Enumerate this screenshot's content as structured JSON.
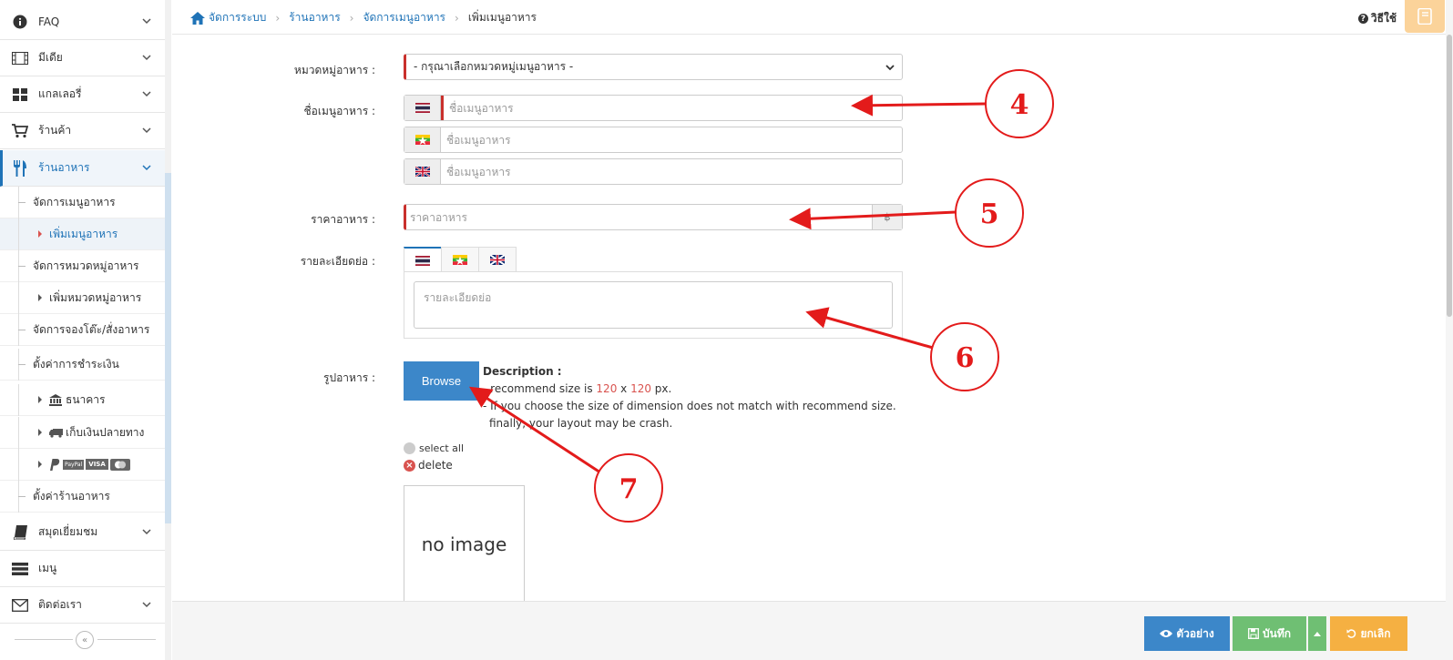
{
  "sidebar": {
    "items": [
      {
        "label": "FAQ",
        "icon": "info-icon"
      },
      {
        "label": "มีเดีย",
        "icon": "film-icon"
      },
      {
        "label": "แกลเลอรี่",
        "icon": "grid-icon"
      },
      {
        "label": "ร้านค้า",
        "icon": "cart-icon"
      },
      {
        "label": "ร้านอาหาร",
        "icon": "utensils-icon"
      },
      {
        "label": "สมุดเยี่ยมชม",
        "icon": "book-icon"
      },
      {
        "label": "เมนู",
        "icon": "menu-icon"
      },
      {
        "label": "ติดต่อเรา",
        "icon": "mail-icon"
      }
    ],
    "sub": [
      {
        "label": "จัดการเมนูอาหาร"
      },
      {
        "label": "เพิ่มเมนูอาหาร"
      },
      {
        "label": "จัดการหมวดหมู่อาหาร"
      },
      {
        "label": "เพิ่มหมวดหมู่อาหาร"
      },
      {
        "label": "จัดการจองโต๊ะ/สั่งอาหาร"
      },
      {
        "label": "ตั้งค่าการชำระเงิน"
      },
      {
        "label": "ธนาคาร"
      },
      {
        "label": "เก็บเงินปลายทาง"
      },
      {
        "label": "ตั้งค่าร้านอาหาร"
      }
    ],
    "paypal_label": "PayPal",
    "visa_label": "VISA"
  },
  "breadcrumb": [
    "จัดการระบบ",
    "ร้านอาหาร",
    "จัดการเมนูอาหาร",
    "เพิ่มเมนูอาหาร"
  ],
  "help_label": "วิธีใช้",
  "form": {
    "category_label": "หมวดหมู่อาหาร :",
    "category_value": "- กรุณาเลือกหมวดหมู่เมนูอาหาร -",
    "name_label": "ชื่อเมนูอาหาร :",
    "name_placeholder": "ชื่อเมนูอาหาร",
    "price_label": "ราคาอาหาร :",
    "price_placeholder": "ราคาอาหาร",
    "detail_label": "รายละเอียดย่อ :",
    "detail_placeholder": "รายละเอียดย่อ",
    "image_label": "รูปอาหาร :",
    "browse_label": "Browse",
    "desc_title": "Description :",
    "desc_line1_a": "- recommend size is ",
    "desc_w": "120",
    "desc_x": " x ",
    "desc_h": "120",
    "desc_line1_b": " px.",
    "desc_line2": "- If you choose the size of dimension does not match with recommend size.",
    "desc_line3": "finally, your layout may be crash.",
    "select_all": "select all",
    "delete": "delete",
    "no_image": "no image"
  },
  "footer": {
    "preview": "ตัวอย่าง",
    "save": "บันทึก",
    "cancel": "ยกเลิก"
  },
  "annotations": [
    "4",
    "5",
    "6",
    "7"
  ],
  "colors": {
    "accent": "#1f73b7",
    "required": "#c9302c",
    "annotation": "#e31b1b",
    "preview_btn": "#3c87c9",
    "save_btn": "#6fbf73",
    "cancel_btn": "#f5b042"
  }
}
